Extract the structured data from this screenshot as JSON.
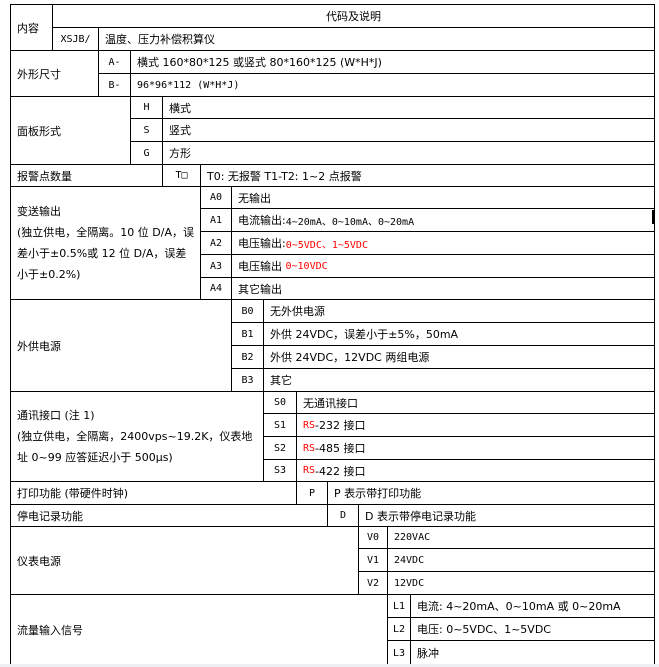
{
  "header": {
    "content_label": "内容",
    "title": "代码及说明",
    "model_code": "XSJB/",
    "model_desc": "温度、压力补偿积算仪"
  },
  "sections": {
    "size": {
      "label": "外形尺寸",
      "options": [
        {
          "code": "A-",
          "desc": "横式 160*80*125 或竖式 80*160*125 (W*H*J)"
        },
        {
          "code": "B-",
          "desc": "96*96*112 (W*H*J)"
        }
      ]
    },
    "panel": {
      "label": "面板形式",
      "options": [
        {
          "code": "H",
          "desc": "横式"
        },
        {
          "code": "S",
          "desc": "竖式"
        },
        {
          "code": "G",
          "desc": "方形"
        }
      ]
    },
    "alarm": {
      "label": "报警点数量",
      "code": "T□",
      "desc": "T0: 无报警  T1-T2: 1~2 点报警"
    },
    "transmit": {
      "label": "变送输出",
      "note": "(独立供电，全隔离。10 位 D/A，误差小于±0.5%或 12 位 D/A，误差小于±0.2%)",
      "options": [
        {
          "code": "A0",
          "desc": "无输出",
          "value": ""
        },
        {
          "code": "A1",
          "desc": "电流输出:",
          "value": "4~20mA、0~10mA、0~20mA",
          "highlight": false
        },
        {
          "code": "A2",
          "desc": "电压输出:",
          "value": "0~5VDC、1~5VDC",
          "highlight": true
        },
        {
          "code": "A3",
          "desc": "电压输出",
          "value": "0~10VDC",
          "highlight": true
        },
        {
          "code": "A4",
          "desc": "其它输出",
          "value": ""
        }
      ]
    },
    "ext_power": {
      "label": "外供电源",
      "options": [
        {
          "code": "B0",
          "desc": "无外供电源"
        },
        {
          "code": "B1",
          "desc": "外供 24VDC，误差小于±5%，50mA"
        },
        {
          "code": "B2",
          "desc": "外供 24VDC，12VDC 两组电源"
        },
        {
          "code": "B3",
          "desc": "其它"
        }
      ]
    },
    "comm": {
      "label": "通讯接口 (注 1)",
      "note": "(独立供电，全隔离，2400vps~19.2K，仪表地址 0~99 应答延迟小于 500μs)",
      "options": [
        {
          "code": "S0",
          "prefix": "",
          "desc": "无通讯接口"
        },
        {
          "code": "S1",
          "prefix": "RS",
          "desc": "-232 接口"
        },
        {
          "code": "S2",
          "prefix": "RS",
          "desc": "-485 接口"
        },
        {
          "code": "S3",
          "prefix": "RS",
          "desc": "-422 接口"
        }
      ]
    },
    "print": {
      "label": "打印功能 (带硬件时钟)",
      "code": "P",
      "desc": "P 表示带打印功能"
    },
    "power_loss": {
      "label": "停电记录功能",
      "code": "D",
      "desc": "D 表示带停电记录功能"
    },
    "instrument_power": {
      "label": "仪表电源",
      "options": [
        {
          "code": "V0",
          "desc": "220VAC"
        },
        {
          "code": "V1",
          "desc": "24VDC"
        },
        {
          "code": "V2",
          "desc": "12VDC"
        }
      ]
    },
    "flow_input": {
      "label": "流量输入信号",
      "options": [
        {
          "code": "L1",
          "desc": "电流: 4~20mA、0~10mA 或 0~20mA"
        },
        {
          "code": "L2",
          "desc": "电压: 0~5VDC、1~5VDC"
        },
        {
          "code": "L3",
          "desc": "脉冲"
        }
      ]
    }
  },
  "colors": {
    "highlight": "#ff0000",
    "border": "#000000"
  }
}
